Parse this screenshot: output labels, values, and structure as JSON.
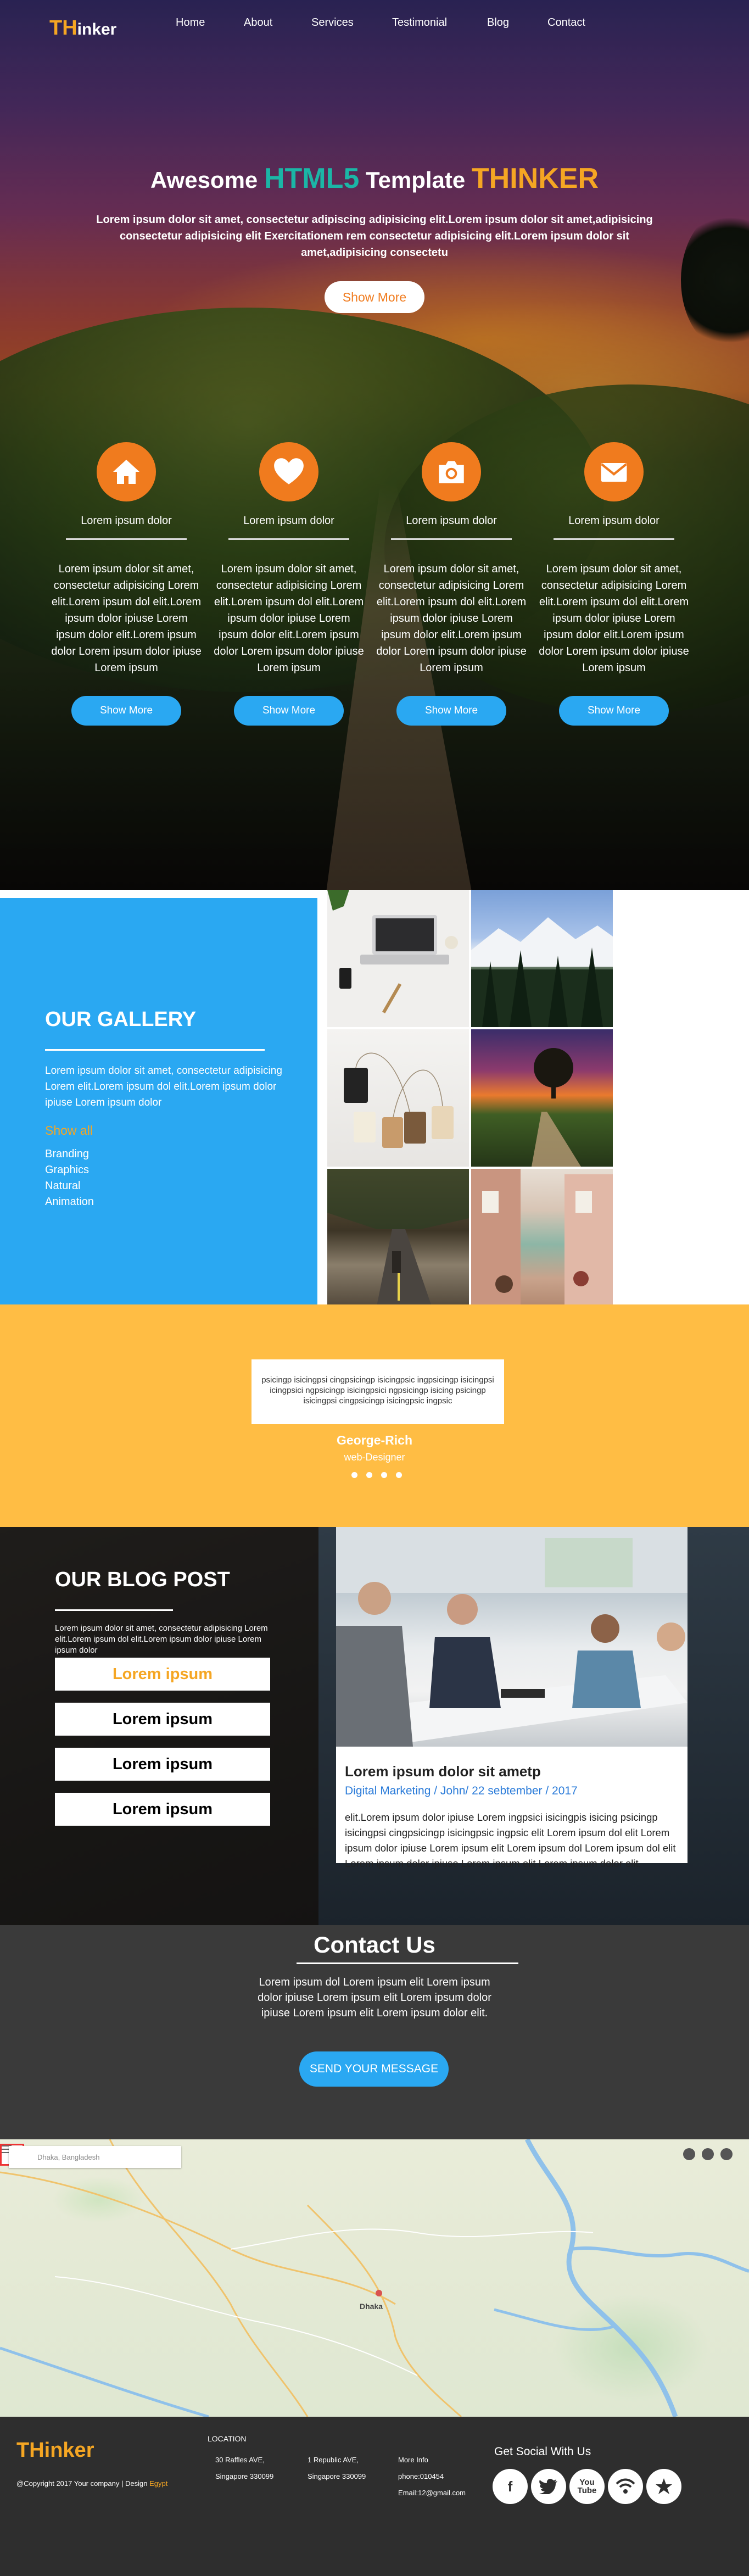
{
  "nav": {
    "logo_th": "TH",
    "logo_rest": "inker",
    "items": [
      "Home",
      "About",
      "Services",
      "Testimonial",
      "Blog",
      "Contact"
    ]
  },
  "hero": {
    "title_pre": "Awesome",
    "title_html5": "HTML5",
    "title_mid": "Template",
    "title_brand": "THINKER",
    "subtitle": "Lorem ipsum dolor sit amet, consectetur adipiscing adipisicing elit.Lorem ipsum dolor sit amet,adipisicing consectetur adipisicing elit Exercitationem rem consectetur adipisicing elit.Lorem ipsum dolor sit amet,adipisicing consectetu",
    "button": "Show More"
  },
  "features": [
    {
      "icon": "home-icon",
      "title": "Lorem ipsum dolor",
      "text": "Lorem ipsum dolor sit amet, consectetur adipisicing Lorem elit.Lorem ipsum dol elit.Lorem ipsum dolor ipiuse Lorem ipsum dolor elit.Lorem ipsum dolor Lorem ipsum dolor ipiuse Lorem ipsum",
      "button": "Show More"
    },
    {
      "icon": "heart-icon",
      "title": "Lorem ipsum dolor",
      "text": "Lorem ipsum dolor sit amet, consectetur adipisicing Lorem elit.Lorem ipsum dol elit.Lorem ipsum dolor ipiuse Lorem ipsum dolor elit.Lorem ipsum dolor Lorem ipsum dolor ipiuse Lorem ipsum",
      "button": "Show More"
    },
    {
      "icon": "camera-icon",
      "title": "Lorem ipsum dolor",
      "text": "Lorem ipsum dolor sit amet, consectetur adipisicing Lorem elit.Lorem ipsum dol elit.Lorem ipsum dolor ipiuse Lorem ipsum dolor elit.Lorem ipsum dolor Lorem ipsum dolor ipiuse Lorem ipsum",
      "button": "Show More"
    },
    {
      "icon": "envelope-icon",
      "title": "Lorem ipsum dolor",
      "text": "Lorem ipsum dolor sit amet, consectetur adipisicing Lorem elit.Lorem ipsum dol elit.Lorem ipsum dolor ipiuse Lorem ipsum dolor elit.Lorem ipsum dolor Lorem ipsum dolor ipiuse Lorem ipsum",
      "button": "Show More"
    }
  ],
  "gallery": {
    "title": "OUR GALLERY",
    "text": "Lorem ipsum dolor sit amet, consectetur adipisicing Lorem elit.Lorem ipsum dol elit.Lorem ipsum dolor ipiuse Lorem ipsum dolor",
    "show_all": "Show all",
    "categories": [
      "Branding",
      "Graphics",
      "Natural",
      "Animation"
    ]
  },
  "testimonial": {
    "quote": "psicingp isicingpsi cingpsicingp isicingpsic ingpsicingp isicingpsi icingpsici ngpsicingp isicingpsici ngpsicingp isicing psicingp isicingpsi cingpsicingp isicingpsic ingpsic",
    "name": "George-Rich",
    "role": "web-Designer",
    "dots": 4
  },
  "blog": {
    "title": "OUR BLOG POST",
    "desc": "Lorem ipsum dolor sit amet, consectetur adipisicing Lorem elit.Lorem ipsum dol elit.Lorem ipsum dolor ipiuse Lorem ipsum dolor",
    "buttons": [
      "Lorem ipsum",
      "Lorem ipsum",
      "Lorem ipsum",
      "Lorem ipsum"
    ],
    "post": {
      "title": "Lorem ipsum dolor sit ametp",
      "meta": "Digital Marketing / John/ 22 sebtember / 2017",
      "body": "elit.Lorem ipsum dolor ipiuse Lorem ingpsici isicingpis isicing psicingp isicingpsi cingpsicingp isicingpsic ingpsic elit Lorem ipsum dol elit Lorem ipsum dolor ipiuse Lorem ipsum elit Lorem ipsum dol Lorem ipsum dol elit Lorem ipsum dolor ipiuse Lorem ipsum elit Lorem ipsum dolor elit."
    }
  },
  "contact": {
    "title": "Contact Us",
    "text": "Lorem ipsum dol Lorem ipsum elit Lorem ipsum dolor ipiuse Lorem ipsum elit Lorem ipsum dolor ipiuse Lorem ipsum elit Lorem ipsum dolor elit.",
    "button": "SEND YOUR MESSAGE"
  },
  "map": {
    "search_placeholder": "Dhaka, Bangladesh",
    "city": "Dhaka"
  },
  "footer": {
    "logo_th": "TH",
    "logo_rest": "inker",
    "copyright": "@Copyright 2017 Your company | Design",
    "copyright_highlight": "Egypt",
    "location_title": "LOCATION",
    "col1": [
      "30 Raffles AVE,",
      "Singapore 330099"
    ],
    "col2": [
      "1 Republic AVE,",
      "Singapore 330099"
    ],
    "col3": [
      "More Info",
      "phone:010454",
      "Email:12@gmail.com"
    ],
    "social_title": "Get Social With Us",
    "social": [
      "f",
      "t",
      "You Tube",
      "wifi",
      "star"
    ]
  },
  "colors": {
    "accent_orange": "#f07b1e",
    "brand_yellow": "#f5a623",
    "blue": "#2aa8f2",
    "teal": "#1bb6a6",
    "testimonial_bg": "#ffbd44"
  }
}
